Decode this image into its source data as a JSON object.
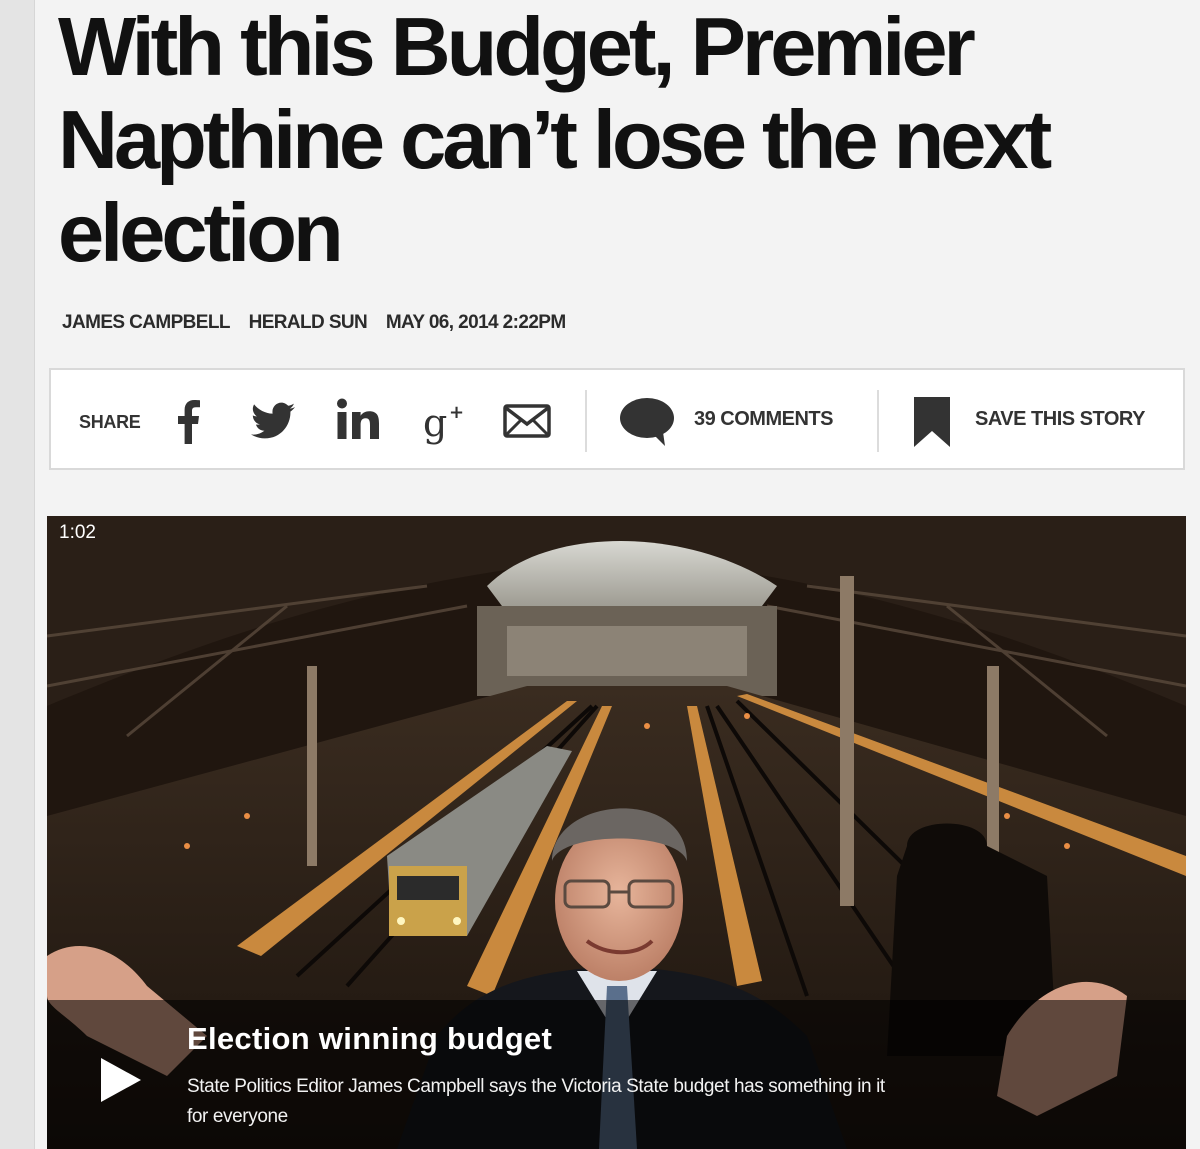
{
  "article": {
    "headline": "With this Budget, Premier Napthine can’t lose the next election",
    "byline": {
      "author": "JAMES CAMPBELL",
      "publication": "HERALD SUN",
      "timestamp": "MAY 06, 2014 2:22PM"
    }
  },
  "share_bar": {
    "share_label": "SHARE",
    "icons": [
      "facebook-icon",
      "twitter-icon",
      "linkedin-icon",
      "googleplus-icon",
      "email-icon"
    ],
    "comments_label": "39 COMMENTS",
    "save_label": "SAVE THIS STORY"
  },
  "video": {
    "duration": "1:02",
    "title": "Election winning budget",
    "description": "State Politics Editor James Campbell says the Victoria State budget has something in it for everyone"
  },
  "colors": {
    "page_background": "#f3f3f3",
    "headline_text": "#111111",
    "caption_overlay": "rgba(0,0,0,0.55)"
  }
}
